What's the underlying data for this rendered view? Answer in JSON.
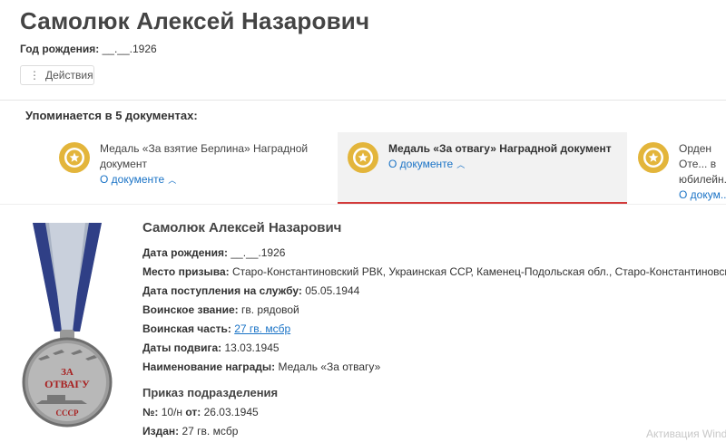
{
  "person": {
    "name": "Самолюк Алексей Назарович",
    "birth_label": "Год рождения:",
    "birth_value": "__.__.1926"
  },
  "actions": {
    "dots": "⋮",
    "label": "Действия"
  },
  "mentions": {
    "title": "Упоминается в 5 документах:"
  },
  "documents": [
    {
      "title": "Медаль «За взятие Берлина» Наградной документ",
      "link": "О документе"
    },
    {
      "title": "Медаль «За отвагу» Наградной документ",
      "link": "О документе"
    },
    {
      "title": "Орден Оте... в юбилейн...",
      "link": "О докум..."
    }
  ],
  "colors": {
    "accent": "#1a73c6",
    "active_underline": "#d23a3a",
    "medal_gold": "#e3b53b"
  },
  "medal_image": {
    "text_top": "ЗА",
    "text_main": "ОТВАГУ",
    "text_bottom": "СССР"
  },
  "detail": {
    "name": "Самолюк Алексей Назарович",
    "fields": {
      "birth": {
        "label": "Дата рождения:",
        "value": "__.__.1926"
      },
      "draft_place": {
        "label": "Место призыва:",
        "value": "Старо-Константиновский РВК, Украинская ССР, Каменец-Подольская обл., Старо-Константиновский р-н"
      },
      "service_start": {
        "label": "Дата поступления на службу:",
        "value": "05.05.1944"
      },
      "rank": {
        "label": "Воинское звание:",
        "value": "гв. рядовой"
      },
      "unit": {
        "label": "Воинская часть:",
        "value": "27 гв. мсбр"
      },
      "feat_dates": {
        "label": "Даты подвига:",
        "value": "13.03.1945"
      },
      "award": {
        "label": "Наименование награды:",
        "value": "Медаль «За отвагу»"
      }
    },
    "order": {
      "title": "Приказ подразделения",
      "number": {
        "label": "№:",
        "value": "10/н",
        "date_label": "от:",
        "date_value": "26.03.1945"
      },
      "issued": {
        "label": "Издан:",
        "value": "27 гв. мсбр"
      }
    }
  },
  "watermark": "Активация Windo"
}
